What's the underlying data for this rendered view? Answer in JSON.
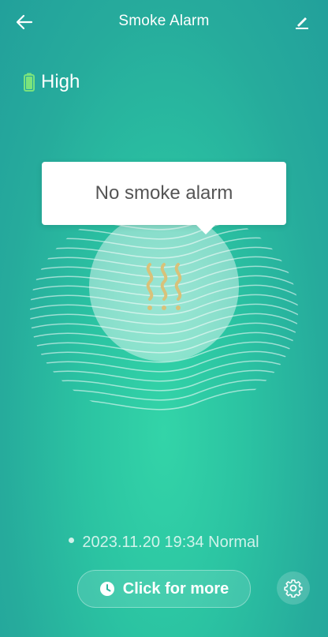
{
  "header": {
    "title": "Smoke Alarm",
    "back_icon": "arrow-left-icon",
    "edit_icon": "pencil-icon"
  },
  "battery": {
    "label": "High",
    "icon": "battery-icon",
    "color": "#7be37c"
  },
  "status": {
    "message": "No smoke alarm",
    "icon": "smoke-icon",
    "icon_color": "#d8c27a"
  },
  "history": {
    "latest": "2023.11.20 19:34 Normal"
  },
  "actions": {
    "more_label": "Click for more",
    "more_icon": "clock-icon",
    "settings_icon": "gear-icon"
  }
}
